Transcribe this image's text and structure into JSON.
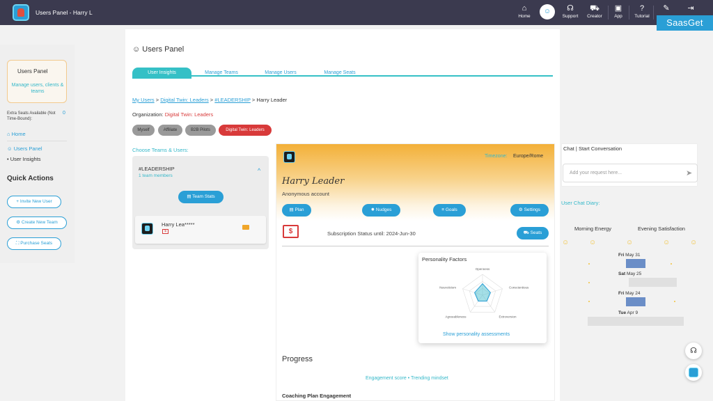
{
  "app": {
    "title": "Users Panel - Harry L"
  },
  "topnav": {
    "items": [
      {
        "label": "Home",
        "icon": "home-icon"
      },
      {
        "label": "Support",
        "icon": "headset-icon"
      },
      {
        "label": "Creator",
        "icon": "cart-icon"
      },
      {
        "label": "App",
        "icon": "app-icon"
      },
      {
        "label": "Tutorial",
        "icon": "help-icon"
      },
      {
        "label": "",
        "icon": "wrench-icon"
      },
      {
        "label": "",
        "icon": "logout-icon"
      }
    ],
    "active_icon": "users-icon"
  },
  "brand": "SaasGet",
  "sidebar": {
    "card_title": "Users Panel",
    "card_desc": "Manage users, clients & teams",
    "extra_seats_label": "Extra Seats Available (Not Time-Bound):",
    "extra_seats_value": "0",
    "home": "Home",
    "users_panel": "Users Panel",
    "user_insights": "User Insights",
    "quick_actions_title": "Quick Actions",
    "quick_actions": [
      "Invite New User",
      "Create New Team",
      "Purchase Seats"
    ]
  },
  "page": {
    "title": "Users Panel",
    "tabs": [
      "User Insights",
      "Manage Teams",
      "Manage Users",
      "Manage Seats"
    ],
    "active_tab": 0
  },
  "breadcrumb": {
    "items": [
      "My Users",
      "Digital Twin: Leaders",
      "#LEADERSHIP"
    ],
    "current": "Harry Leader"
  },
  "organization": {
    "label": "Organization:",
    "value": "Digital Twin: Leaders",
    "chips": [
      "Myself",
      "Affiliate",
      "B2B Pilots",
      "Digital Twin: Leaders"
    ]
  },
  "teams": {
    "title": "Choose Teams & Users:",
    "team_name": "#LEADERSHIP",
    "team_members": "1 team members",
    "team_stats_label": "Team Stats",
    "member_name": "Harry Lea*****"
  },
  "profile": {
    "timezone_label": "Timezone:",
    "timezone_value": "Europe/Rome",
    "name": "Harry Leader",
    "subtitle": "Anonymous account",
    "buttons": [
      "Plan",
      "Nudges",
      "Goals",
      "Settings"
    ],
    "subscription_status": "Subscription Status until: 2024-Jun-30",
    "seats_label": "Seats",
    "personality_title": "Personality Factors",
    "radar_axes": [
      "Openness",
      "Conscientious",
      "Extroversion",
      "Agreeableness",
      "Neuroticism"
    ],
    "radar_values": [
      0.55,
      0.4,
      0.35,
      0.35,
      0.4
    ],
    "show_assessments": "Show personality assessments",
    "progress_title": "Progress",
    "engagement_link": "Engagement score • Trending mindset",
    "coaching_title": "Coaching Plan Engagement"
  },
  "chat": {
    "title": "Chat | Start Conversation",
    "placeholder": "Add your request here..."
  },
  "diary": {
    "title": "User Chat Diary:",
    "morning_label": "Morning Energy",
    "evening_label": "Evening Satisfaction",
    "entries": [
      {
        "weekday": "Fri",
        "date": "May 31",
        "level": 0.2,
        "color": "#6b8ec7"
      },
      {
        "weekday": "Sat",
        "date": "May 25",
        "level": 0.5,
        "color": "#e0e0e0"
      },
      {
        "weekday": "Fri",
        "date": "May 24",
        "level": 0.2,
        "color": "#6b8ec7"
      },
      {
        "weekday": "Tue",
        "date": "Apr 9",
        "level": 1.0,
        "color": "#e0e0e0"
      }
    ]
  },
  "colors": {
    "accent": "#2a9fd6",
    "teal": "#35c0c6",
    "red": "#d83a3a",
    "topbar": "#3b3a4f",
    "card_gradient_top": "#f3b038"
  }
}
